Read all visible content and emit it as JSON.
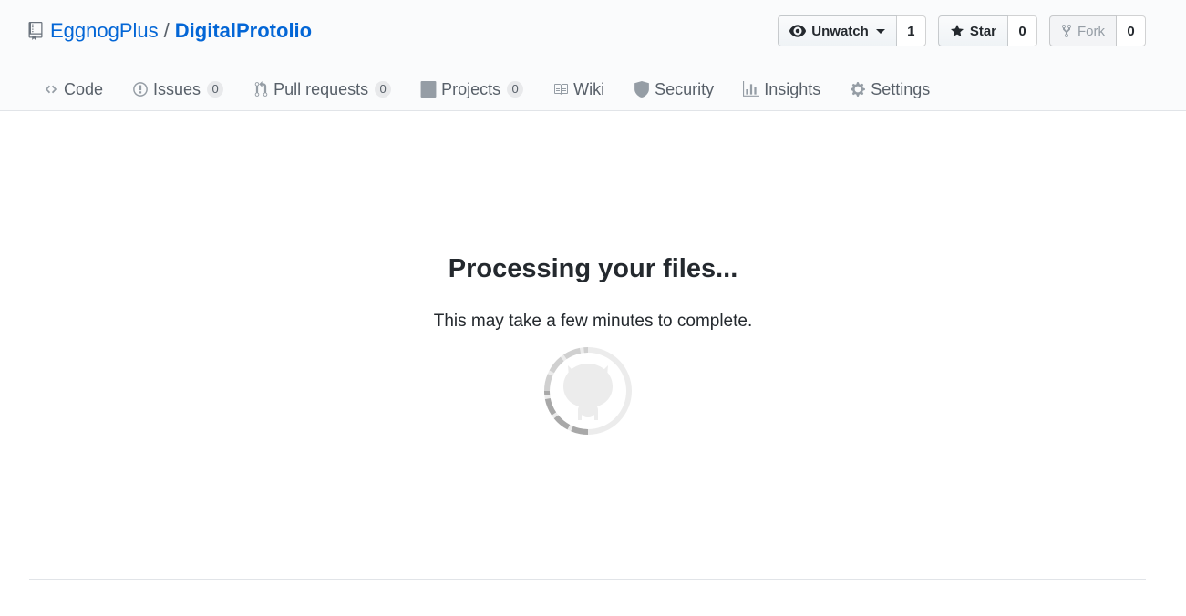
{
  "repo": {
    "owner": "EggnogPlus",
    "separator": "/",
    "name": "DigitalProtolio"
  },
  "actions": {
    "watch": {
      "label": "Unwatch",
      "count": "1",
      "icon": "eye-icon"
    },
    "star": {
      "label": "Star",
      "count": "0",
      "icon": "star-icon"
    },
    "fork": {
      "label": "Fork",
      "count": "0",
      "icon": "repo-forked-icon",
      "disabled": true
    }
  },
  "tabs": [
    {
      "label": "Code",
      "icon": "code-icon"
    },
    {
      "label": "Issues",
      "count": "0",
      "icon": "issue-opened-icon"
    },
    {
      "label": "Pull requests",
      "count": "0",
      "icon": "git-pull-request-icon"
    },
    {
      "label": "Projects",
      "count": "0",
      "icon": "project-icon"
    },
    {
      "label": "Wiki",
      "icon": "book-icon"
    },
    {
      "label": "Security",
      "icon": "shield-icon"
    },
    {
      "label": "Insights",
      "icon": "graph-icon"
    },
    {
      "label": "Settings",
      "icon": "gear-icon"
    }
  ],
  "processing": {
    "title": "Processing your files...",
    "subtitle": "This may take a few minutes to complete.",
    "icon": "octocat-spinner-icon"
  },
  "colors": {
    "link": "#0366d6",
    "text": "#24292e",
    "muted": "#586069",
    "header_bg": "#fafbfc",
    "border": "#e1e4e8"
  }
}
